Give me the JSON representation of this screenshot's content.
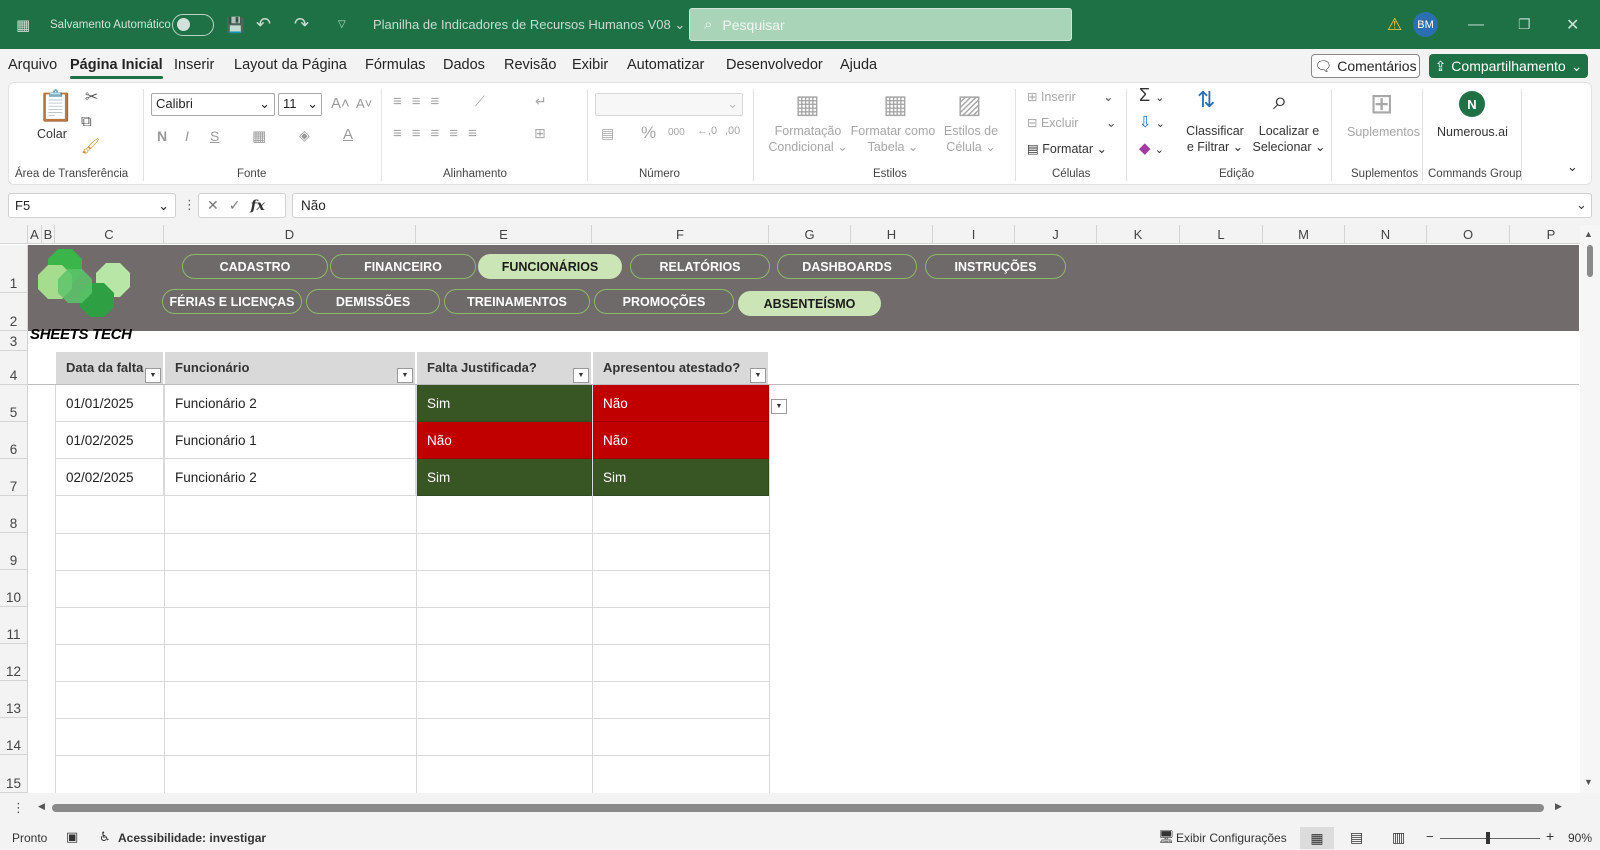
{
  "titlebar": {
    "autosave_label": "Salvamento Automático",
    "document_title": "Planilha de Indicadores de Recursos Humanos V08",
    "search_placeholder": "Pesquisar",
    "avatar_initials": "BM"
  },
  "menu": {
    "items": [
      "Arquivo",
      "Página Inicial",
      "Inserir",
      "Layout da Página",
      "Fórmulas",
      "Dados",
      "Revisão",
      "Exibir",
      "Automatizar",
      "Desenvolvedor",
      "Ajuda"
    ],
    "active": "Página Inicial",
    "comments": "Comentários",
    "share": "Compartilhamento"
  },
  "ribbon": {
    "paste": "Colar",
    "clipboard_group": "Área de Transferência",
    "font_name": "Calibri",
    "font_size": "11",
    "bold": "N",
    "italic": "I",
    "underline": "S",
    "font_group": "Fonte",
    "alignment_group": "Alinhamento",
    "number_group": "Número",
    "conditional_format_1": "Formatação",
    "conditional_format_2": "Condicional",
    "format_table_1": "Formatar como",
    "format_table_2": "Tabela",
    "cell_styles_1": "Estilos de",
    "cell_styles_2": "Célula",
    "styles_group": "Estilos",
    "insert": "Inserir",
    "delete": "Excluir",
    "format": "Formatar",
    "cells_group": "Células",
    "sort_filter_1": "Classificar",
    "sort_filter_2": "e Filtrar",
    "find_select_1": "Localizar e",
    "find_select_2": "Selecionar",
    "editing_group": "Edição",
    "addins": "Suplementos",
    "addins_group": "Suplementos",
    "numerous": "Numerous.ai",
    "commands_group": "Commands Group"
  },
  "formula": {
    "name_box": "F5",
    "fx": "fx",
    "value": "Não"
  },
  "columns": [
    "A",
    "B",
    "C",
    "D",
    "E",
    "F",
    "G",
    "H",
    "I",
    "J",
    "K",
    "L",
    "M",
    "N",
    "O",
    "P"
  ],
  "rows": [
    "1",
    "2",
    "3",
    "4",
    "5",
    "6",
    "7",
    "8",
    "9",
    "10",
    "11",
    "12",
    "13",
    "14",
    "15"
  ],
  "nav": {
    "row1": [
      "CADASTRO",
      "FINANCEIRO",
      "FUNCIONÁRIOS",
      "RELATÓRIOS",
      "DASHBOARDS",
      "INSTRUÇÕES"
    ],
    "row2": [
      "FÉRIAS E LICENÇAS",
      "DEMISSÕES",
      "TREINAMENTOS",
      "PROMOÇÕES",
      "ABSENTEÍSMO"
    ]
  },
  "brand": "SHEETS TECH",
  "table": {
    "headers": [
      "Data da falta",
      "Funcionário",
      "Falta Justificada?",
      "Apresentou atestado?"
    ],
    "rows": [
      [
        "01/01/2025",
        "Funcionário 2",
        "Sim",
        "Não"
      ],
      [
        "01/02/2025",
        "Funcionário 1",
        "Não",
        "Não"
      ],
      [
        "02/02/2025",
        "Funcionário 2",
        "Sim",
        "Sim"
      ]
    ]
  },
  "status": {
    "ready": "Pronto",
    "accessibility": "Acessibilidade: investigar",
    "display_settings": "Exibir Configurações",
    "zoom": "90%"
  },
  "colors": {
    "excel_green": "#1e7145",
    "banner_gray": "#716b6b",
    "pill_active": "#cce5b6",
    "yes_green": "#375623",
    "no_red": "#c00000"
  }
}
